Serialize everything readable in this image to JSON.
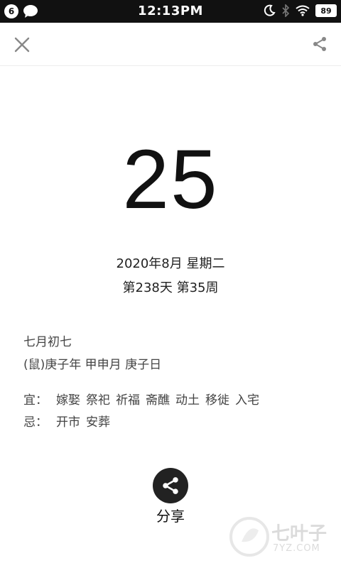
{
  "status_bar": {
    "notification_count": "6",
    "time": "12:13PM",
    "battery": "89"
  },
  "toolbar": {
    "close_icon": "close-icon",
    "share_icon": "share-icon"
  },
  "calendar": {
    "day": "25",
    "date_line": "2020年8月  星期二",
    "week_line": "第238天  第35周",
    "lunar_date": "七月初七",
    "ganzhi": "(鼠)庚子年   甲申月   庚子日",
    "yi_label": "宜：",
    "yi_items": [
      "嫁娶",
      "祭祀",
      "祈福",
      "斋醮",
      "动土",
      "移徙",
      "入宅"
    ],
    "ji_label": "忌：",
    "ji_items": [
      "开市",
      "安葬"
    ]
  },
  "share": {
    "label": "分享"
  },
  "watermark": {
    "name": "七叶子",
    "url": "7YZ.COM"
  }
}
